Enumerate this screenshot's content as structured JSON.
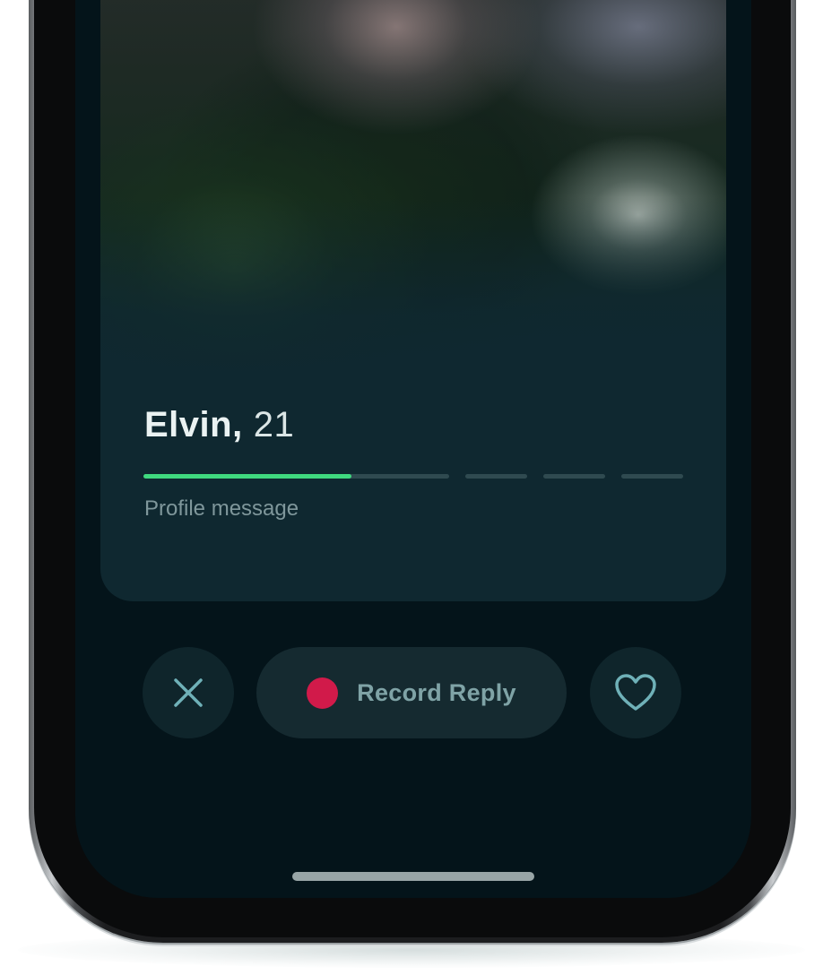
{
  "profile": {
    "name": "Elvin,",
    "age": "21",
    "message_placeholder": "Profile message"
  },
  "progress": {
    "segments": [
      {
        "fill": 0.68
      },
      {
        "fill": 0
      },
      {
        "fill": 0
      },
      {
        "fill": 0
      }
    ]
  },
  "actions": {
    "dismiss_icon": "close-icon",
    "record_label": "Record Reply",
    "record_icon": "record-dot-icon",
    "like_icon": "heart-icon"
  },
  "colors": {
    "accent_green": "#3fd97f",
    "record_red": "#d11a4a",
    "icon_teal": "#6fb1b8",
    "background": "#04141a"
  }
}
